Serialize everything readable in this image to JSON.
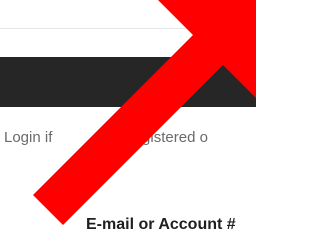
{
  "page": {
    "login_text": "Login if",
    "login_text_tail": "registered o",
    "email_label": "E-mail or Account #"
  },
  "overlay": {
    "arrow_icon": "arrow-up-right-icon",
    "color": "#ff0000"
  }
}
